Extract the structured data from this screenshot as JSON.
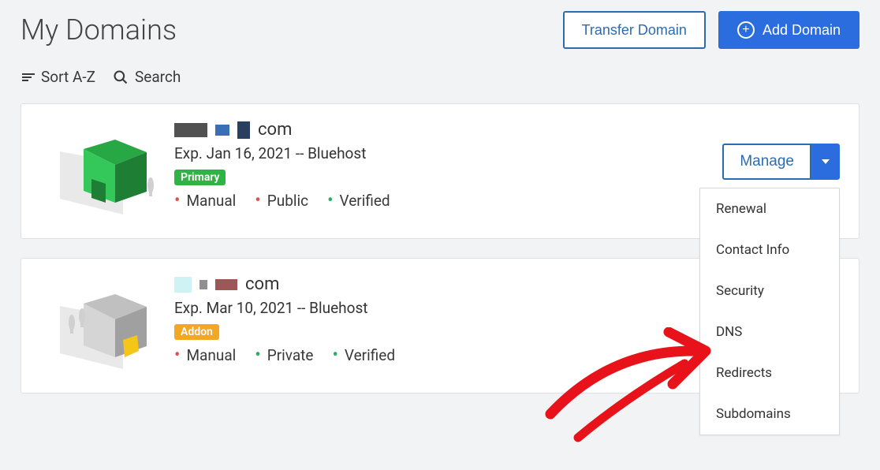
{
  "header": {
    "title": "My Domains",
    "transfer_label": "Transfer Domain",
    "add_label": "Add Domain"
  },
  "toolbar": {
    "sort_label": "Sort A-Z",
    "search_label": "Search"
  },
  "domains": [
    {
      "tld": "com",
      "exp_line": "Exp. Jan 16, 2021 -- Bluehost",
      "badge": "Primary",
      "attrs": [
        {
          "dot": "red",
          "label": "Manual"
        },
        {
          "dot": "red",
          "label": "Public"
        },
        {
          "dot": "green",
          "label": "Verified"
        }
      ],
      "manage_label": "Manage"
    },
    {
      "tld": "com",
      "exp_line": "Exp. Mar 10, 2021 -- Bluehost",
      "badge": "Addon",
      "attrs": [
        {
          "dot": "red",
          "label": "Manual"
        },
        {
          "dot": "green",
          "label": "Private"
        },
        {
          "dot": "green",
          "label": "Verified"
        }
      ]
    }
  ],
  "dropdown": {
    "items": [
      "Renewal",
      "Contact Info",
      "Security",
      "DNS",
      "Redirects",
      "Subdomains"
    ]
  }
}
